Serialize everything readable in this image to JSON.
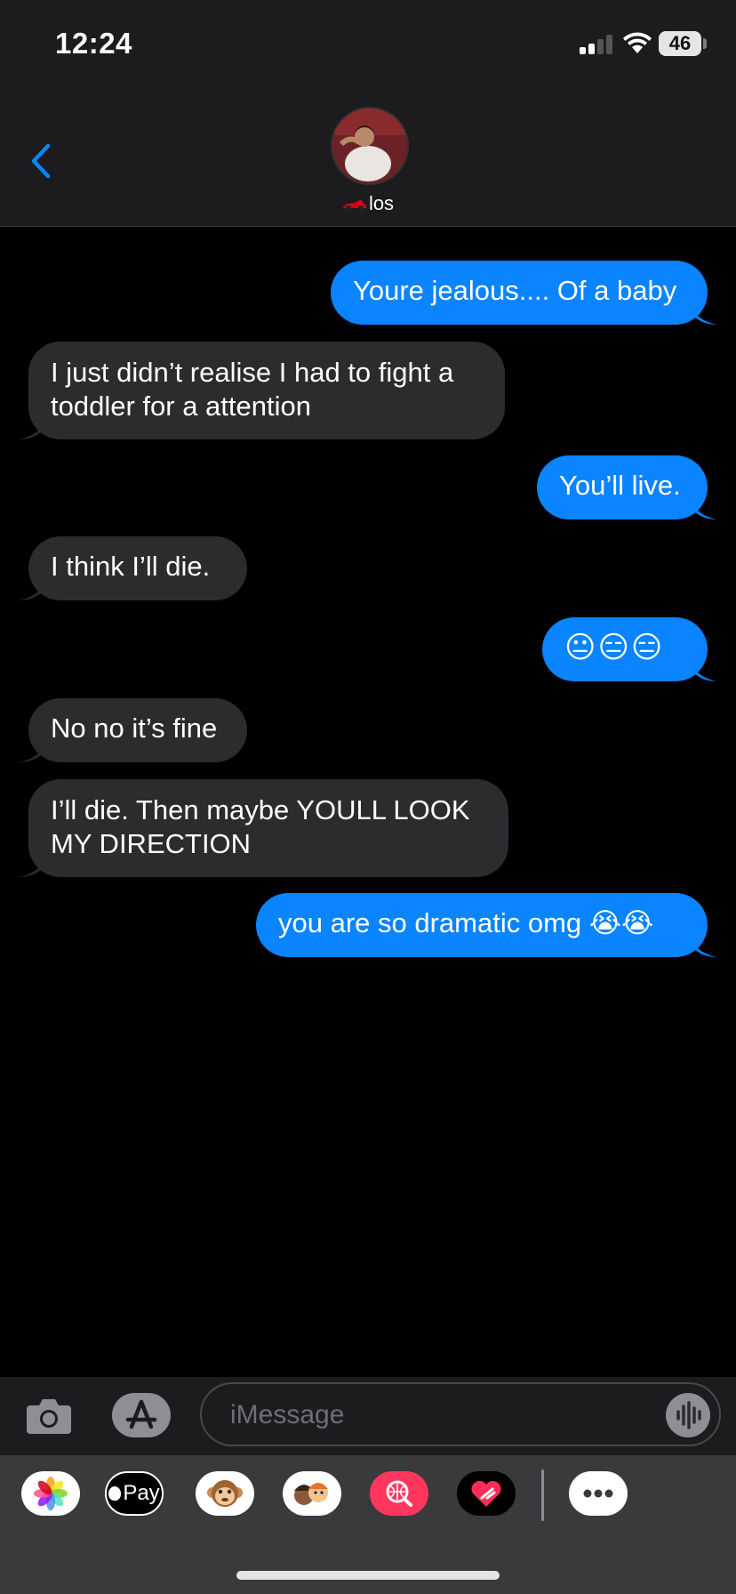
{
  "status_bar": {
    "time": "12:24",
    "battery": "46"
  },
  "header": {
    "contact_name": "los"
  },
  "messages": [
    {
      "direction": "outgoing",
      "text": "Youre jealous.... Of a baby"
    },
    {
      "direction": "incoming",
      "line1": "I just didn’t realise I had to fight a",
      "line2": "toddler for a attention"
    },
    {
      "direction": "outgoing",
      "text": "You’ll live."
    },
    {
      "direction": "incoming",
      "text": "I think I’ll die."
    },
    {
      "direction": "outgoing",
      "text": "😐😑😑"
    },
    {
      "direction": "incoming",
      "text": "No no it’s fine"
    },
    {
      "direction": "incoming",
      "line1": "I’ll die. Then maybe YOULL LOOK",
      "line2": "MY DIRECTION"
    },
    {
      "direction": "outgoing",
      "text": "you are so dramatic omg 😭😭"
    }
  ],
  "composer": {
    "placeholder": "iMessage"
  },
  "app_drawer": {
    "apple_pay_label": "Pay",
    "apps": [
      "photos-icon",
      "apple-pay-icon",
      "animoji-monkey-icon",
      "memoji-icon",
      "images-search-icon",
      "digital-touch-icon",
      "more-icon"
    ]
  },
  "colors": {
    "outgoing_bubble": "#0a84ff",
    "incoming_bubble": "#2c2c2e",
    "accent": "#0a84ff"
  }
}
